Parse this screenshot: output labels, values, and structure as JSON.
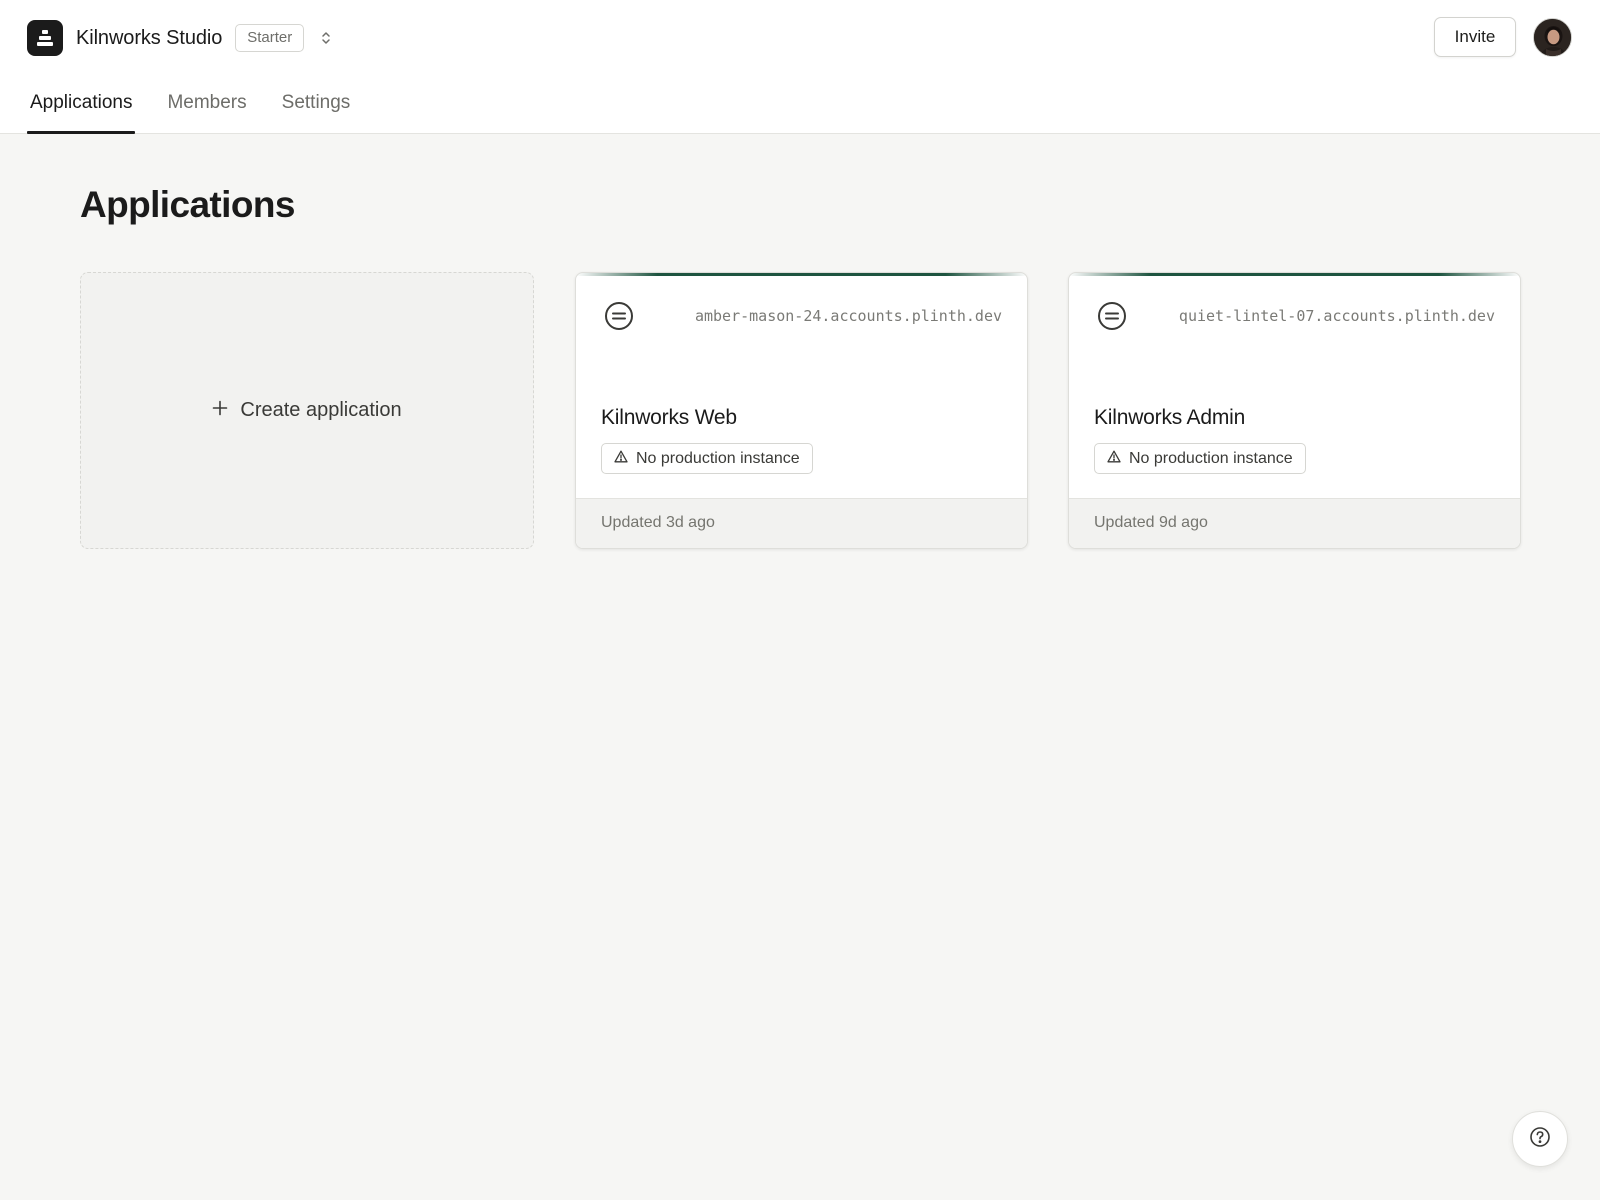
{
  "header": {
    "org_name": "Kilnworks Studio",
    "plan": "Starter",
    "invite_label": "Invite"
  },
  "tabs": [
    {
      "label": "Applications",
      "active": true
    },
    {
      "label": "Members",
      "active": false
    },
    {
      "label": "Settings",
      "active": false
    }
  ],
  "main": {
    "title": "Applications",
    "create_label": "Create application",
    "apps": [
      {
        "name": "Kilnworks Web",
        "domain": "amber-mason-24.accounts.plinth.dev",
        "status": "No production instance",
        "updated": "Updated 3d ago"
      },
      {
        "name": "Kilnworks Admin",
        "domain": "quiet-lintel-07.accounts.plinth.dev",
        "status": "No production instance",
        "updated": "Updated 9d ago"
      }
    ]
  },
  "colors": {
    "accent": "#1e5440",
    "background": "#f6f6f4",
    "text": "#1b1b1b"
  },
  "icons": {
    "logo": "stack-logo-icon",
    "switcher": "chevron-up-down-icon",
    "create": "plus-icon",
    "app": "app-logo-icon",
    "status": "warning-triangle-icon",
    "help": "help-circle-icon"
  }
}
